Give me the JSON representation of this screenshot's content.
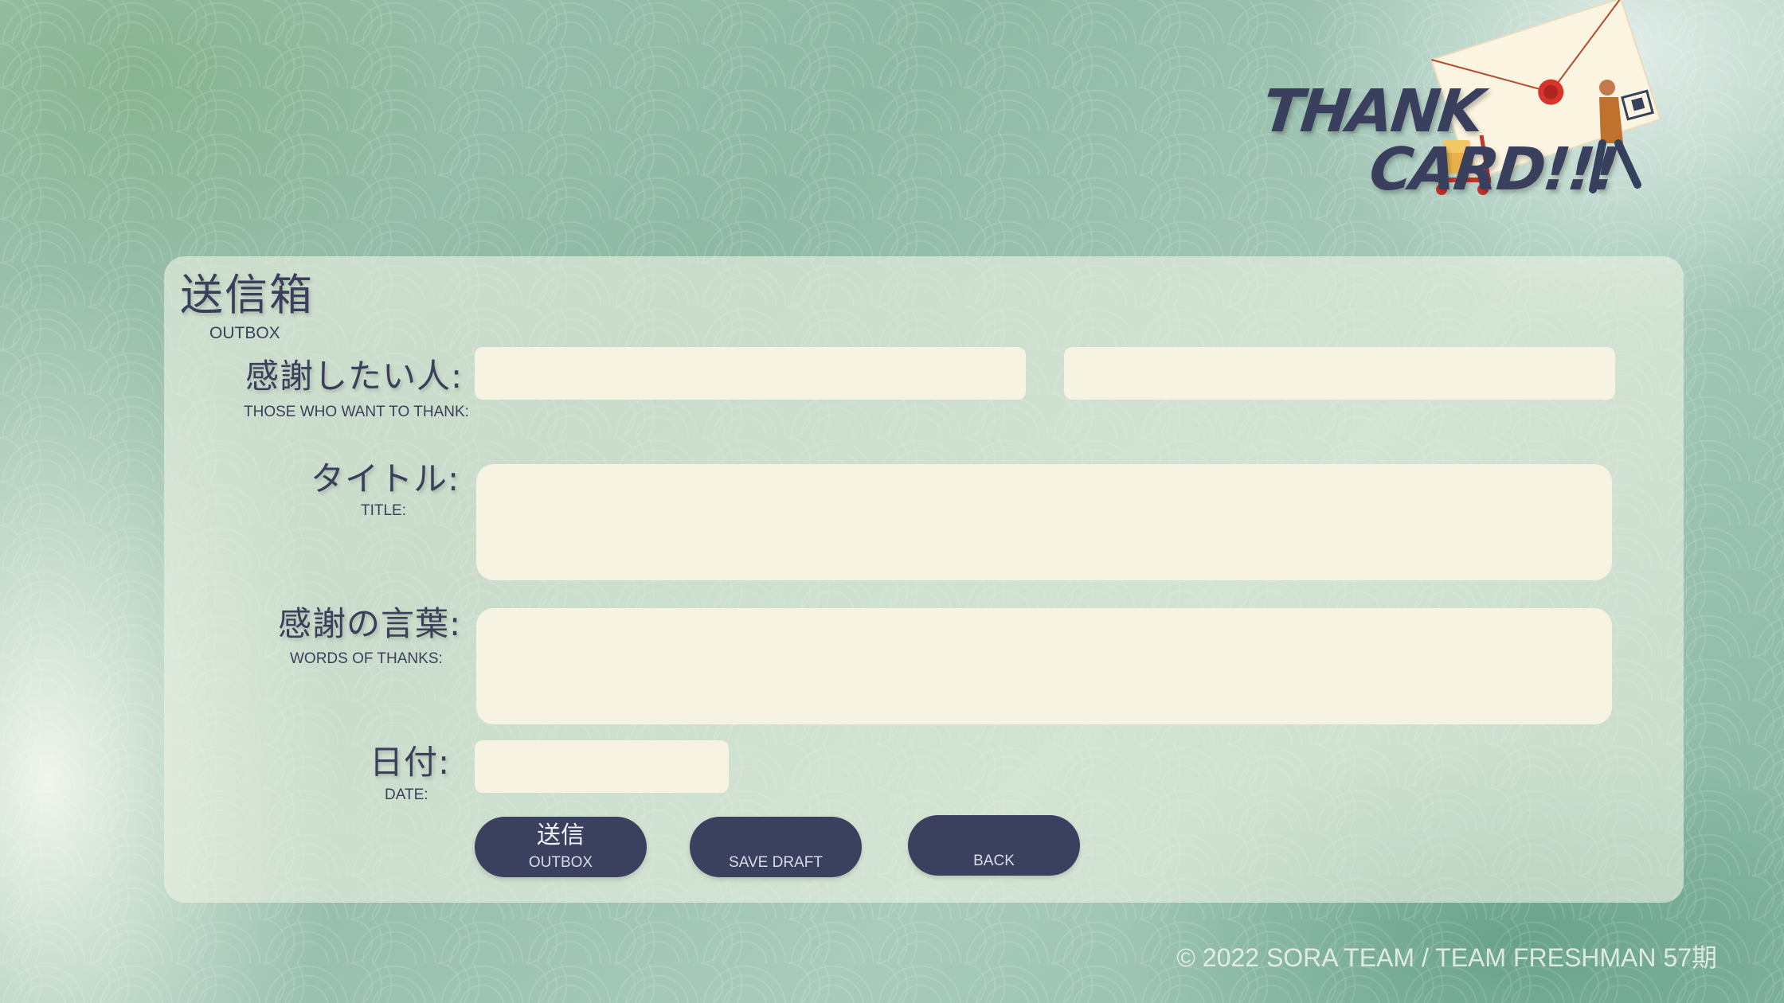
{
  "logo": {
    "line1": "THANK",
    "line2": "CARD!!!"
  },
  "page": {
    "title_jp": "送信箱",
    "title_en": "OUTBOX"
  },
  "form": {
    "recipients": {
      "label_jp": "感謝したい人:",
      "label_en": "THOSE WHO WANT TO THANK:",
      "value1": "",
      "value2": ""
    },
    "title": {
      "label_jp": "タイトル:",
      "label_en": "TITLE:",
      "value": ""
    },
    "message": {
      "label_jp": "感謝の言葉:",
      "label_en": "WORDS OF THANKS:",
      "value": ""
    },
    "date": {
      "label_jp": "日付:",
      "label_en": "DATE:",
      "value": ""
    }
  },
  "buttons": {
    "send": {
      "label_jp": "送信",
      "label_en": "OUTBOX"
    },
    "draft": {
      "label_en": "SAVE DRAFT"
    },
    "back": {
      "label_en": "BACK"
    }
  },
  "footer": {
    "text": "© 2022 SORA TEAM / TEAM FRESHMAN 57期"
  },
  "colors": {
    "accent": "#3b405e",
    "field_bg": "#f7f3e2",
    "text": "#3b3f5c"
  },
  "icons": [
    "envelope-icon",
    "delivery-person-icon"
  ]
}
